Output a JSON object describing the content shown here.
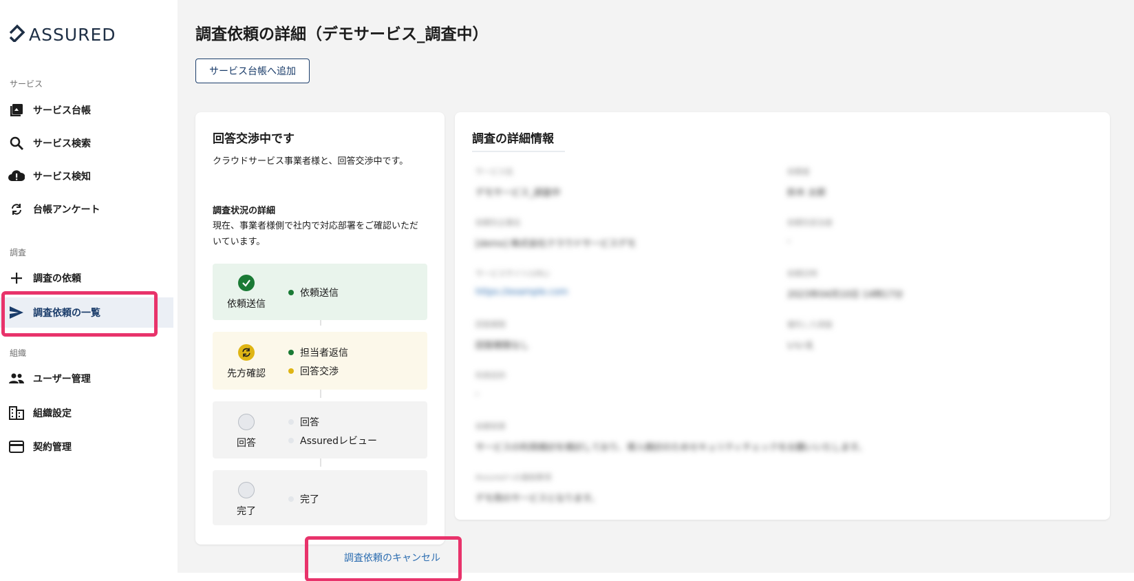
{
  "brand": {
    "logo_text": "ASSURED",
    "accent": "#1a3c6a",
    "highlight": "#e8336b"
  },
  "sidebar": {
    "sections": [
      {
        "label": "サービス"
      },
      {
        "label": "調査"
      },
      {
        "label": "組織"
      }
    ],
    "items": [
      {
        "label": "サービス台帳",
        "icon": "ledger-icon"
      },
      {
        "label": "サービス検索",
        "icon": "search-icon"
      },
      {
        "label": "サービス検知",
        "icon": "cloud-alert-icon"
      },
      {
        "label": "台帳アンケート",
        "icon": "sync-icon"
      },
      {
        "label": "調査の依頼",
        "icon": "plus-icon"
      },
      {
        "label": "調査依頼の一覧",
        "icon": "send-icon"
      },
      {
        "label": "ユーザー管理",
        "icon": "users-icon"
      },
      {
        "label": "組織設定",
        "icon": "building-icon"
      },
      {
        "label": "契約管理",
        "icon": "credit-card-icon"
      }
    ]
  },
  "main": {
    "title": "調査依頼の詳細（デモサービス_調査中）",
    "add_button": "サービス台帳へ追加",
    "status_card": {
      "title": "回答交渉中です",
      "description": "クラウドサービス事業者様と、回答交渉中です。",
      "detail_title": "調査状況の詳細",
      "detail_text": "現在、事業者様側で社内で対応部署をご確認いただいています。",
      "steps": [
        {
          "name": "依頼送信",
          "subs": [
            "依頼送信"
          ]
        },
        {
          "name": "先方確認",
          "subs": [
            "担当者返信",
            "回答交渉"
          ]
        },
        {
          "name": "回答",
          "subs": [
            "回答",
            "Assuredレビュー"
          ]
        },
        {
          "name": "完了",
          "subs": [
            "完了"
          ]
        }
      ]
    },
    "detail_card": {
      "title": "調査の詳細情報",
      "fields": [
        {
          "label": "サービス名",
          "value": "デモサービス_調査中"
        },
        {
          "label": "依頼者",
          "value": "鈴木 太郎"
        },
        {
          "label": "依頼先企業名",
          "value": "[demo] 株式会社クラウドサービスデモ"
        },
        {
          "label": "依頼先担当者",
          "value": "-"
        },
        {
          "label": "サービスサイト(URL)",
          "value": "https://example.com"
        },
        {
          "label": "依頼日時",
          "value": "2023年04月10日 14時17分"
        },
        {
          "label": "回答期限",
          "value": "回答期限なし"
        },
        {
          "label": "優先した調査",
          "value": "いいえ"
        },
        {
          "label": "利用目的",
          "value": "-"
        },
        {
          "label": "依頼背景",
          "value": "サービスの利用検討を検討しており、導入検討のためセキュリティチェックをお願いいたします。"
        },
        {
          "label": "Assuredへの連絡事項",
          "value": "デモ用のサービスとなります。"
        }
      ]
    },
    "cancel_link": "調査依頼のキャンセル"
  }
}
